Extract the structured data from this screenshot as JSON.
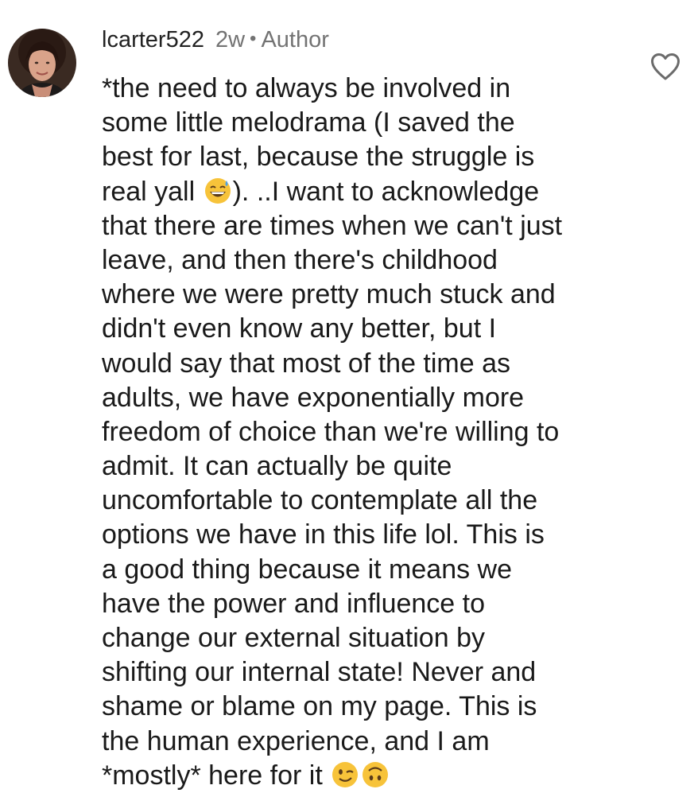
{
  "comment": {
    "username": "lcarter522",
    "time": "2w",
    "separator": "•",
    "role": "Author",
    "lines": [
      "*the need to always be involved in",
      "some little melodrama (I saved the",
      "best for last, because the struggle is",
      {
        "before": "real yall ",
        "emoji": "grinning-sweat-emoji",
        "after": "). ..I want to acknowledge"
      },
      "that there are times when we can't just",
      "leave, and then there's childhood",
      "where we were pretty much stuck and",
      "didn't even know any better, but I",
      "would say that most of the time as",
      "adults, we have exponentially more",
      "freedom of choice than we're willing to",
      "admit. It can actually be quite",
      "uncomfortable to contemplate all the",
      "options we have in this life lol. This is",
      "a good thing because it means we",
      "have the power and influence to",
      "change our external situation by",
      "shifting our internal state! Never and",
      "shame or blame on my page. This is",
      "the human experience, and I am",
      {
        "before": "*mostly* here for it ",
        "emojis": [
          "winking-face-emoji",
          "upside-down-face-emoji"
        ]
      }
    ]
  },
  "icons": {
    "like": "heart-outline-icon",
    "avatar": "profile-photo"
  },
  "colors": {
    "text": "#1a1a1a",
    "muted": "#737373",
    "emoji_yellow": "#f7c33a"
  }
}
